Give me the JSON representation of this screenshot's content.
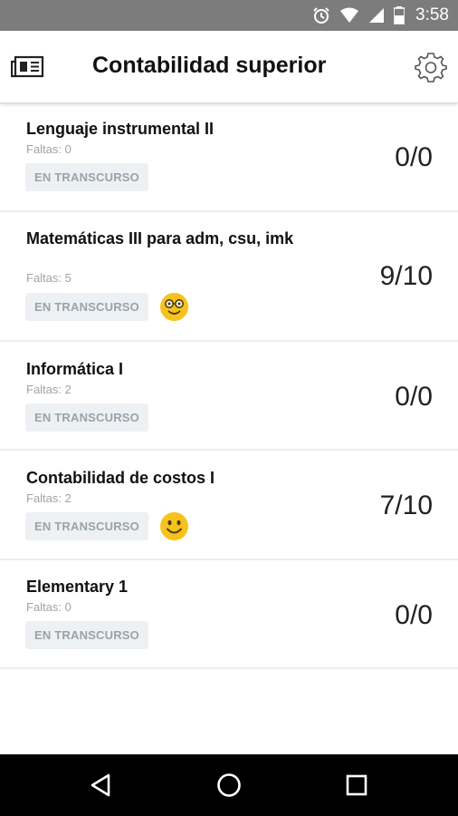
{
  "status_bar": {
    "time": "3:58",
    "icons": [
      "alarm-icon",
      "wifi-icon",
      "signal-icon",
      "battery-icon"
    ]
  },
  "app_bar": {
    "title": "Contabilidad superior",
    "left_icon": "news-icon",
    "right_icon": "gear-icon"
  },
  "courses": [
    {
      "name": "Lenguaje instrumental II",
      "faltas": "Faltas: 0",
      "status": "EN TRANSCURSO",
      "score": "0/0",
      "emoji": null
    },
    {
      "name": "Matemáticas III para adm, csu, imk",
      "faltas": "Faltas: 5",
      "status": "EN TRANSCURSO",
      "score": "9/10",
      "emoji": "nerd-smiley-icon"
    },
    {
      "name": "Informática I",
      "faltas": "Faltas: 2",
      "status": "EN TRANSCURSO",
      "score": "0/0",
      "emoji": null
    },
    {
      "name": "Contabilidad de costos I",
      "faltas": "Faltas: 2",
      "status": "EN TRANSCURSO",
      "score": "7/10",
      "emoji": "smiley-icon"
    },
    {
      "name": "Elementary 1",
      "faltas": "Faltas: 0",
      "status": "EN TRANSCURSO",
      "score": "0/0",
      "emoji": null
    }
  ],
  "nav_bar": {
    "buttons": [
      "back-icon",
      "home-icon",
      "recents-icon"
    ]
  },
  "colors": {
    "status_bar_bg": "#7c7c7c",
    "badge_bg": "#eef1f3",
    "badge_text": "#9aa3a8",
    "emoji_yellow": "#f7c21c"
  }
}
